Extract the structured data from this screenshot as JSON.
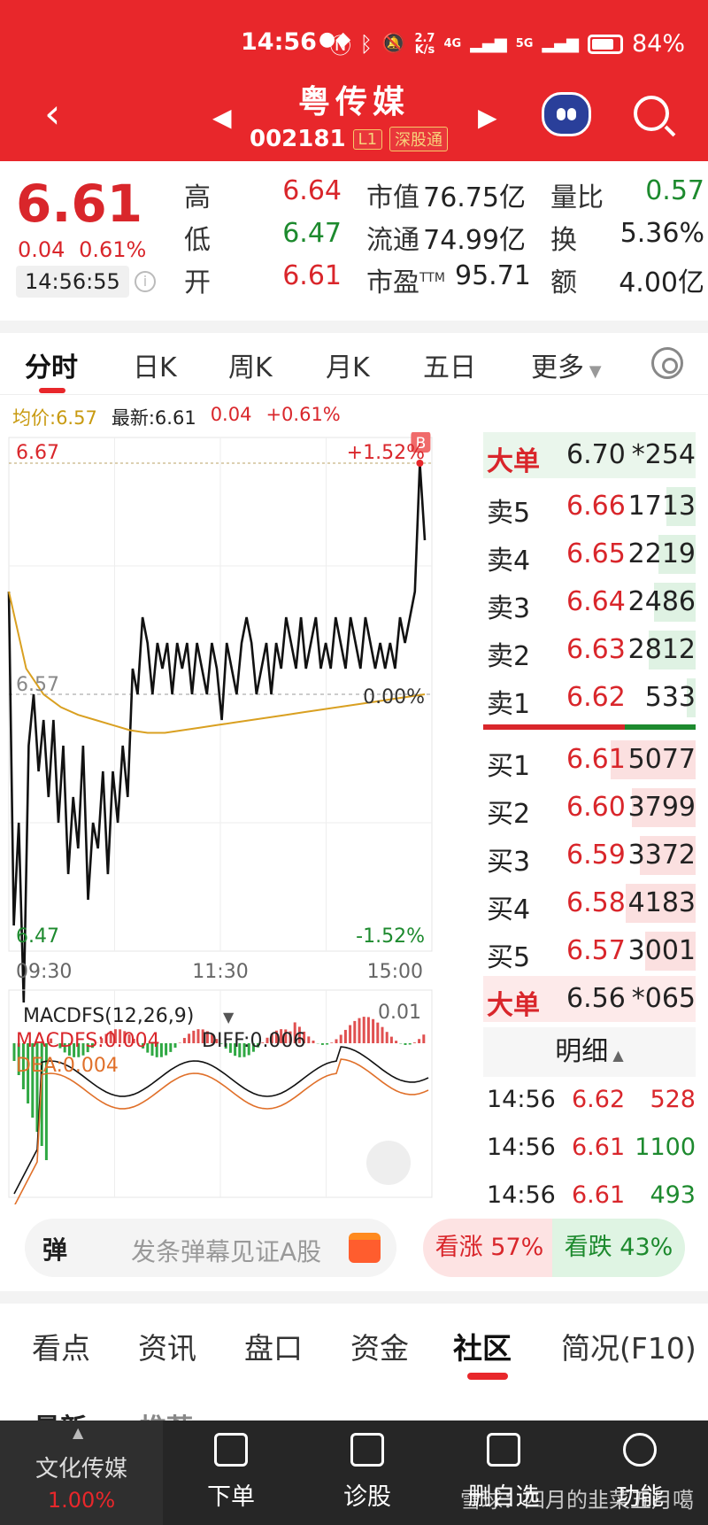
{
  "status": {
    "time": "14:56",
    "net_speed_top": "2.7",
    "net_speed_bottom": "K/s",
    "signal_a": "4G",
    "signal_b": "5G",
    "battery": "84%"
  },
  "header": {
    "name": "粤传媒",
    "code": "002181",
    "tag_l1": "L1",
    "tag_connect": "深股通"
  },
  "quote": {
    "price": "6.61",
    "change": "0.04",
    "change_pct": "0.61%",
    "time": "14:56:55",
    "high_label": "高",
    "high": "6.64",
    "low_label": "低",
    "low": "6.47",
    "open_label": "开",
    "open": "6.61",
    "mktcap_label": "市值",
    "mktcap": "76.75亿",
    "float_label": "流通",
    "float": "74.99亿",
    "pe_label": "市盈",
    "pe_sup": "TTM",
    "pe": "95.71",
    "volratio_label": "量比",
    "volratio": "0.57",
    "turnover_label": "换",
    "turnover": "5.36%",
    "amount_label": "额",
    "amount": "4.00亿"
  },
  "chart_tabs": [
    "分时",
    "日K",
    "周K",
    "月K",
    "五日",
    "更多"
  ],
  "legend": {
    "avg": "均价:6.57",
    "last": "最新:6.61",
    "chg": "0.04",
    "pct": "+0.61%"
  },
  "chart_data": {
    "type": "line",
    "title": "",
    "ylim": [
      6.47,
      6.67
    ],
    "ref_price": 6.57,
    "y_ticks_left": [
      "6.67",
      "6.57",
      "6.47"
    ],
    "y_ticks_right": [
      "+1.52%",
      "0.00%",
      "-1.52%"
    ],
    "x_ticks": [
      "09:30",
      "11:30",
      "15:00"
    ],
    "series": [
      {
        "values": [
          6.61,
          6.48,
          6.52,
          6.45,
          6.55,
          6.57,
          6.54,
          6.56,
          6.53,
          6.56,
          6.52,
          6.55,
          6.5,
          6.53,
          6.51,
          6.55,
          6.49,
          6.52,
          6.51,
          6.54,
          6.5,
          6.54,
          6.52,
          6.55,
          6.53,
          6.58,
          6.57,
          6.6,
          6.59,
          6.57,
          6.59,
          6.58,
          6.59,
          6.57,
          6.59,
          6.58,
          6.59,
          6.57,
          6.59,
          6.58,
          6.57,
          6.59,
          6.58,
          6.56,
          6.59,
          6.58,
          6.57,
          6.59,
          6.6,
          6.59,
          6.57,
          6.58,
          6.59,
          6.57,
          6.59,
          6.58,
          6.6,
          6.59,
          6.58,
          6.6,
          6.58,
          6.59,
          6.6,
          6.58,
          6.59,
          6.58,
          6.6,
          6.59,
          6.58,
          6.6,
          6.59,
          6.58,
          6.6,
          6.59,
          6.58,
          6.59,
          6.58,
          6.59,
          6.58,
          6.6,
          6.59,
          6.6,
          6.61,
          6.66,
          6.63
        ]
      },
      {
        "values": [
          6.61,
          6.58,
          6.57,
          6.565,
          6.562,
          6.56,
          6.558,
          6.556,
          6.555,
          6.555,
          6.556,
          6.557,
          6.558,
          6.559,
          6.56,
          6.561,
          6.562,
          6.563,
          6.564,
          6.565,
          6.566,
          6.567,
          6.568,
          6.569,
          6.57
        ]
      }
    ],
    "macd": {
      "label": "MACDFS(12,26,9)",
      "macd": "MACDFS:0.004",
      "diff": "DIFF:0.006",
      "dea": "DEA:0.004",
      "top": "0.01"
    }
  },
  "book": {
    "big_sell": {
      "label": "大单",
      "price": "6.70",
      "vol": "*254"
    },
    "asks": [
      {
        "label": "卖5",
        "price": "6.66",
        "vol": "1713",
        "fill": 0.34
      },
      {
        "label": "卖4",
        "price": "6.65",
        "vol": "2219",
        "fill": 0.44
      },
      {
        "label": "卖3",
        "price": "6.64",
        "vol": "2486",
        "fill": 0.49
      },
      {
        "label": "卖2",
        "price": "6.63",
        "vol": "2812",
        "fill": 0.55
      },
      {
        "label": "卖1",
        "price": "6.62",
        "vol": "533",
        "fill": 0.1
      }
    ],
    "bids": [
      {
        "label": "买1",
        "price": "6.61",
        "vol": "5077",
        "fill": 1.0
      },
      {
        "label": "买2",
        "price": "6.60",
        "vol": "3799",
        "fill": 0.75
      },
      {
        "label": "买3",
        "price": "6.59",
        "vol": "3372",
        "fill": 0.66
      },
      {
        "label": "买4",
        "price": "6.58",
        "vol": "4183",
        "fill": 0.82
      },
      {
        "label": "买5",
        "price": "6.57",
        "vol": "3001",
        "fill": 0.59
      }
    ],
    "big_buy": {
      "label": "大单",
      "price": "6.56",
      "vol": "*065"
    },
    "detail_label": "明细",
    "trades": [
      {
        "time": "14:56",
        "price": "6.62",
        "vol": "528"
      },
      {
        "time": "14:56",
        "price": "6.61",
        "vol": "1100"
      },
      {
        "time": "14:56",
        "price": "6.61",
        "vol": "493"
      }
    ]
  },
  "danmaku": {
    "badge": "弹",
    "placeholder": "发条弹幕见证A股",
    "up": "看涨 57%",
    "down": "看跌 43%"
  },
  "bottom_tabs": [
    "看点",
    "资讯",
    "盘口",
    "资金",
    "社区",
    "简况(F10)"
  ],
  "sub_tabs": [
    "最新",
    "推荐"
  ],
  "nav": {
    "sector_name": "文化传媒",
    "sector_pct": "1.00%",
    "items": [
      "下单",
      "诊股",
      "删自选",
      "功能"
    ],
    "watermark": "雪球：四月的韭菜五月噶"
  }
}
